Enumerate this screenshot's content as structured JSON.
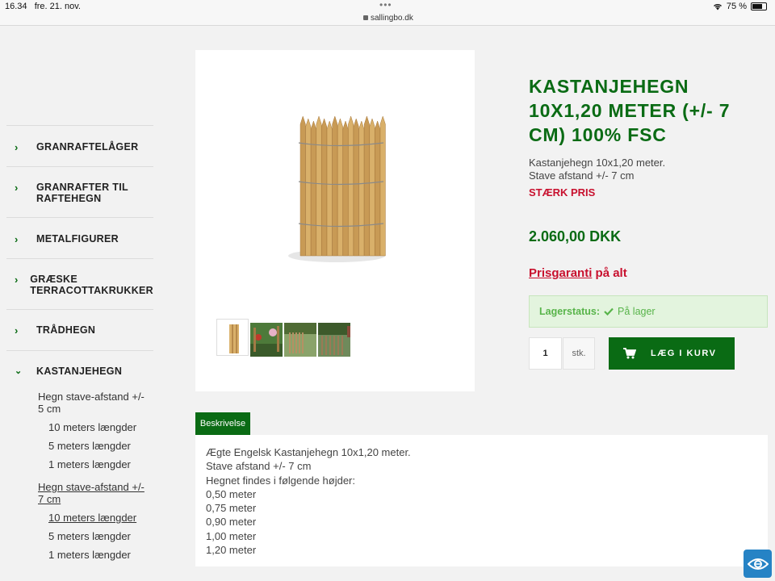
{
  "status_bar": {
    "time": "16.34",
    "date": "fre. 21. nov.",
    "url": "sallingbo.dk",
    "battery": "75 %",
    "battery_level": 0.75
  },
  "sidebar": {
    "categories": [
      {
        "label_1": "GRANRAFTELÅGER",
        "label_2": "",
        "icon": "chevron-right-icon"
      },
      {
        "label_1": "GRANRAFTER TIL",
        "label_2": "RAFTEHEGN",
        "icon": "chevron-right-icon"
      },
      {
        "label_1": "METALFIGURER",
        "label_2": "",
        "icon": "chevron-right-icon"
      },
      {
        "label_1": "GRÆSKE",
        "label_2": "TERRACOTTAKRUKKER",
        "icon": "chevron-right-icon"
      },
      {
        "label_1": "TRÅDHEGN",
        "label_2": "",
        "icon": "chevron-right-icon"
      },
      {
        "label_1": "KASTANJEHEGN",
        "label_2": "",
        "icon": "chevron-down-icon"
      }
    ],
    "subgroups": [
      {
        "title_1": "Hegn stave-afstand +/-",
        "title_2": "5 cm",
        "items": [
          "10 meters længder",
          "5 meters længder",
          "1 meters længder"
        ]
      },
      {
        "title_1": "Hegn stave-afstand +/-",
        "title_2": "7 cm",
        "items": [
          "10 meters længder",
          "5 meters længder",
          "1 meters længder"
        ]
      }
    ]
  },
  "product": {
    "title_lines": [
      "KASTANJEHEGN",
      "10X1,20 METER (+/- 7",
      "CM) 100% FSC"
    ],
    "desc_lines": [
      "Kastanjehegn 10x1,20 meter.",
      "Stave afstand +/- 7 cm"
    ],
    "badge": "STÆRK PRIS",
    "price": "2.060,00 DKK",
    "guarantee_link": "Prisgaranti",
    "guarantee_rest": " på alt",
    "stock_label": "Lagerstatus:",
    "stock_value": "På lager",
    "quantity": "1",
    "unit": "stk.",
    "cart_button": "LÆG I KURV"
  },
  "description": {
    "tab_label": "Beskrivelse",
    "lines": [
      "Ægte Engelsk Kastanjehegn 10x1,20 meter.",
      "Stave afstand +/- 7 cm",
      "Hegnet findes i følgende højder:",
      "0,50 meter",
      "0,75 meter",
      "0,90 meter",
      "1,00 meter",
      "1,20 meter"
    ]
  },
  "colors": {
    "brand_green": "#0a6b14",
    "accent_red": "#c8102e",
    "stock_bg": "#e3f4de",
    "stock_text": "#58b44a"
  }
}
